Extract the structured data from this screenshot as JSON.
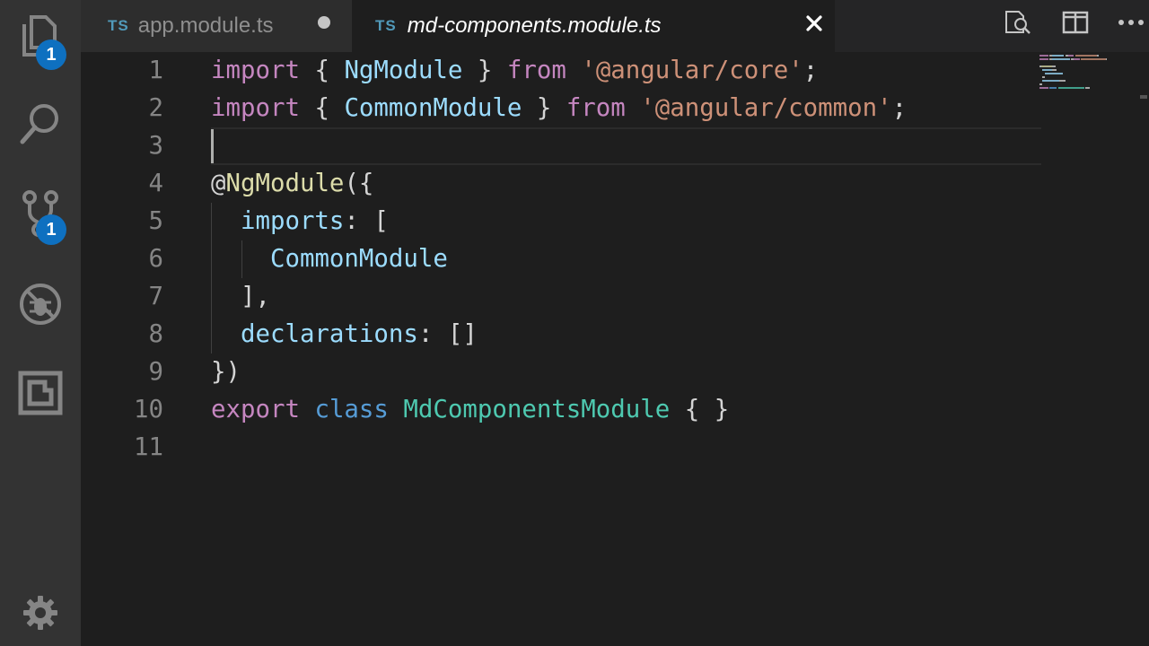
{
  "activity_bar": {
    "explorer_badge": "1",
    "scm_badge": "1",
    "icons": [
      "files-icon",
      "search-icon",
      "source-control-icon",
      "debug-icon",
      "extensions-icon",
      "gear-icon"
    ]
  },
  "tabs": [
    {
      "lang": "TS",
      "name": "app.module.ts",
      "modified": true,
      "active": false
    },
    {
      "lang": "TS",
      "name": "md-components.module.ts",
      "modified": false,
      "active": true
    }
  ],
  "editor": {
    "line_numbers": [
      "1",
      "2",
      "3",
      "4",
      "5",
      "6",
      "7",
      "8",
      "9",
      "10",
      "11"
    ],
    "lines": [
      [
        {
          "t": "import",
          "c": "kw"
        },
        {
          "t": " { ",
          "c": "pn"
        },
        {
          "t": "NgModule",
          "c": "id"
        },
        {
          "t": " } ",
          "c": "pn"
        },
        {
          "t": "from",
          "c": "kw"
        },
        {
          "t": " ",
          "c": "pn"
        },
        {
          "t": "'@angular/core'",
          "c": "str"
        },
        {
          "t": ";",
          "c": "pn"
        }
      ],
      [
        {
          "t": "import",
          "c": "kw"
        },
        {
          "t": " { ",
          "c": "pn"
        },
        {
          "t": "CommonModule",
          "c": "id"
        },
        {
          "t": " } ",
          "c": "pn"
        },
        {
          "t": "from",
          "c": "kw"
        },
        {
          "t": " ",
          "c": "pn"
        },
        {
          "t": "'@angular/common'",
          "c": "str"
        },
        {
          "t": ";",
          "c": "pn"
        }
      ],
      [],
      [
        {
          "t": "@",
          "c": "pn"
        },
        {
          "t": "NgModule",
          "c": "fn"
        },
        {
          "t": "({",
          "c": "pn"
        }
      ],
      [
        {
          "t": "  ",
          "c": "pn"
        },
        {
          "t": "imports",
          "c": "id"
        },
        {
          "t": ": [",
          "c": "pn"
        }
      ],
      [
        {
          "t": "    ",
          "c": "pn"
        },
        {
          "t": "CommonModule",
          "c": "id"
        }
      ],
      [
        {
          "t": "  ],",
          "c": "pn"
        }
      ],
      [
        {
          "t": "  ",
          "c": "pn"
        },
        {
          "t": "declarations",
          "c": "id"
        },
        {
          "t": ": []",
          "c": "pn"
        }
      ],
      [
        {
          "t": "})",
          "c": "pn"
        }
      ],
      [
        {
          "t": "export",
          "c": "kw"
        },
        {
          "t": " ",
          "c": "pn"
        },
        {
          "t": "class",
          "c": "kb"
        },
        {
          "t": " ",
          "c": "pn"
        },
        {
          "t": "MdComponentsModule",
          "c": "cls"
        },
        {
          "t": " { }",
          "c": "pn"
        }
      ],
      []
    ]
  }
}
